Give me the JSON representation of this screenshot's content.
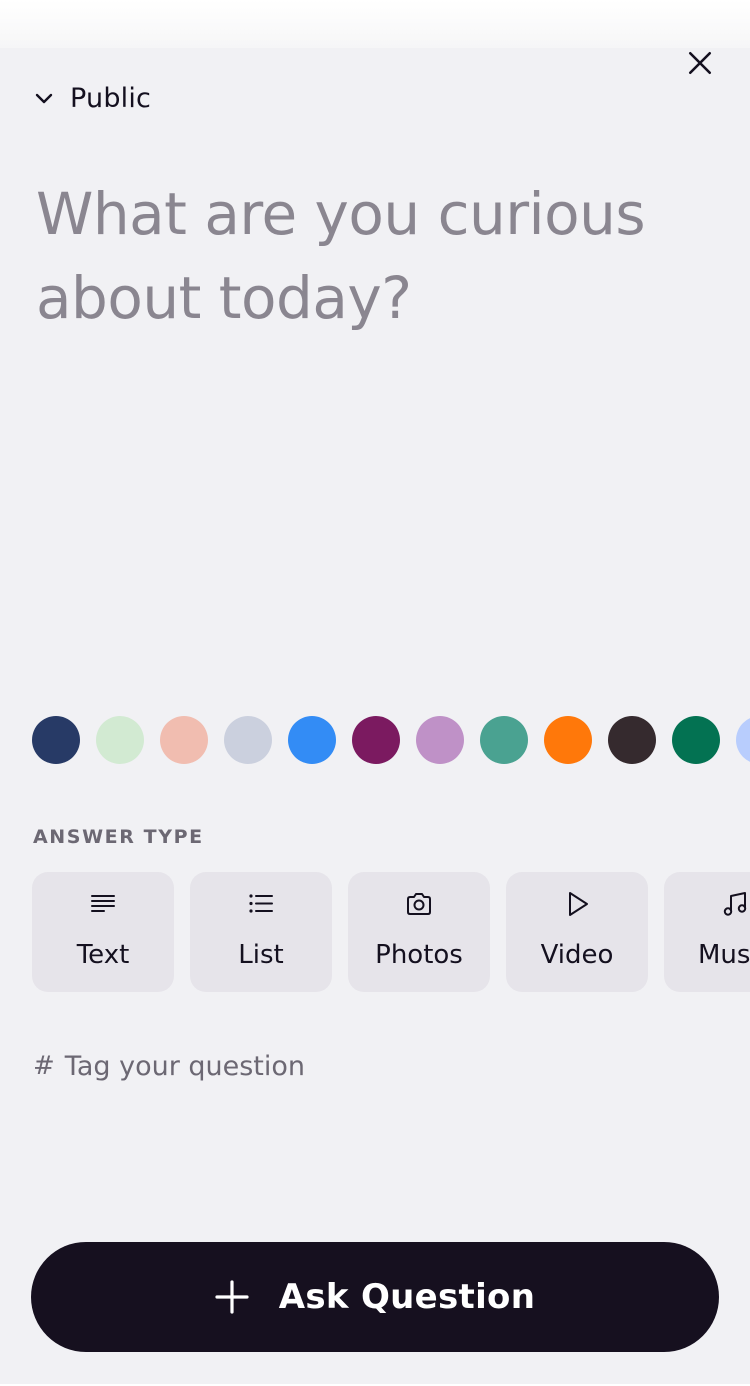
{
  "header": {
    "visibility_label": "Public",
    "visibility_icon": "chevron-down-icon",
    "close_icon": "close-icon"
  },
  "question": {
    "placeholder": "What are you curious about today?"
  },
  "colors": [
    "#273a66",
    "#d2ead2",
    "#f1bdb0",
    "#cbd0de",
    "#338cf5",
    "#7b1a60",
    "#bf91c7",
    "#4aa291",
    "#ff780a",
    "#352a2e",
    "#037252",
    "#b8cdfd"
  ],
  "answer_type": {
    "label": "ANSWER TYPE",
    "options": [
      {
        "label": "Text",
        "icon": "text-lines-icon"
      },
      {
        "label": "List",
        "icon": "list-icon"
      },
      {
        "label": "Photos",
        "icon": "camera-icon"
      },
      {
        "label": "Video",
        "icon": "play-icon"
      },
      {
        "label": "Music",
        "icon": "music-note-icon"
      }
    ]
  },
  "tags": {
    "prefix": "#",
    "placeholder": "Tag your question"
  },
  "submit": {
    "label": "Ask Question",
    "icon": "plus-icon"
  }
}
